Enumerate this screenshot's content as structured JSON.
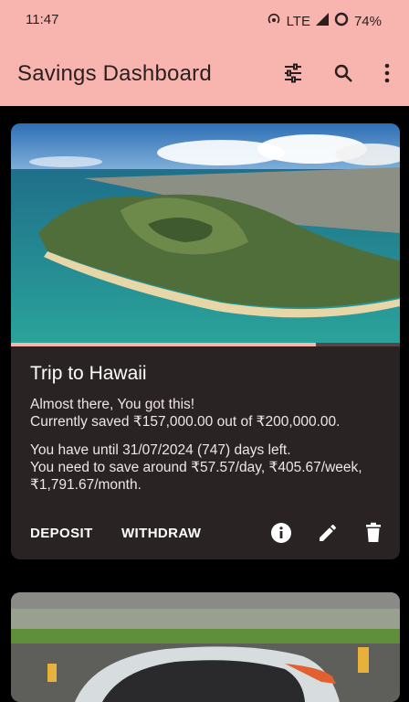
{
  "status_bar": {
    "time": "11:47",
    "network": "LTE",
    "battery": "74%"
  },
  "app_bar": {
    "title": "Savings Dashboard",
    "actions": [
      "tune-icon",
      "search-icon",
      "more-vert-icon"
    ]
  },
  "goals": [
    {
      "title": "Trip to Hawaii",
      "progress_fraction": 0.785,
      "message": "Almost there, You got this!",
      "saved_line": "Currently saved ₹157,000.00 out of ₹200,000.00.",
      "deadline_line": "You have until 31/07/2024 (747) days left.",
      "rate_line_1": "You need to save around ₹57.57/day, ₹405.67/week,",
      "rate_line_2": "₹1,791.67/month.",
      "deposit_label": "DEPOSIT",
      "withdraw_label": "WITHDRAW",
      "icons": [
        "info-icon",
        "edit-icon",
        "delete-icon"
      ]
    }
  ],
  "colors": {
    "accent": "#f8b4ae",
    "card_bg": "#2a2324",
    "page_bg": "#000000"
  }
}
